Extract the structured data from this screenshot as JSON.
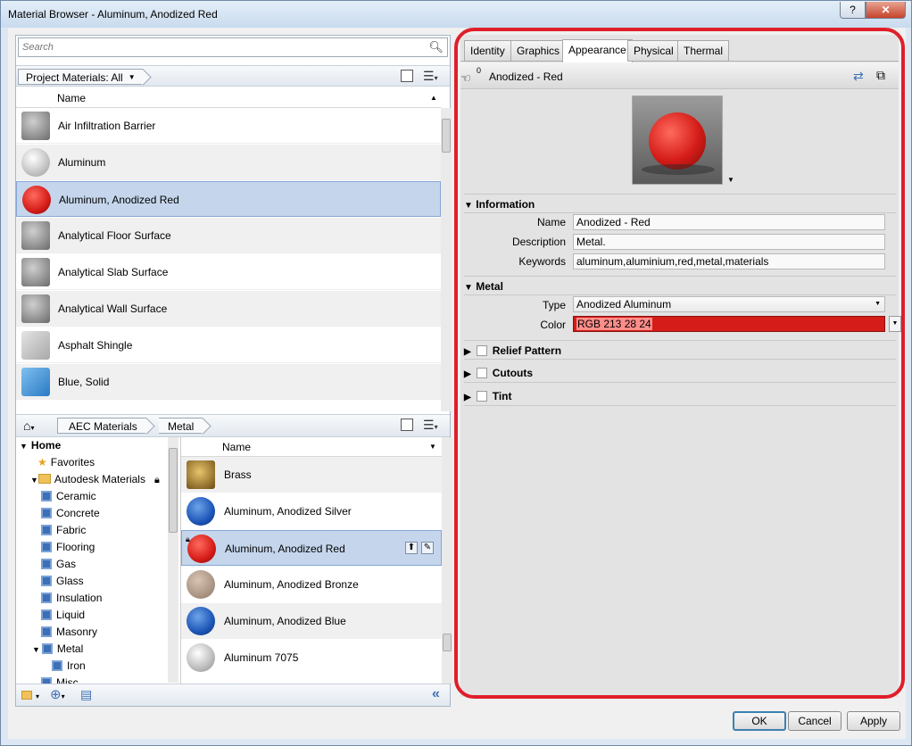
{
  "window": {
    "title": "Material Browser - Aluminum, Anodized Red",
    "help": "?",
    "close": "✕"
  },
  "search": {
    "placeholder": "Search"
  },
  "project": {
    "filter_label": "Project Materials: All",
    "column_name": "Name",
    "items": [
      {
        "label": "Air Infiltration Barrier",
        "swatch": "sphere-gray"
      },
      {
        "label": "Aluminum",
        "swatch": "sphere-silver"
      },
      {
        "label": "Aluminum, Anodized Red",
        "swatch": "sphere-red"
      },
      {
        "label": "Analytical Floor Surface",
        "swatch": "sphere-gray"
      },
      {
        "label": "Analytical Slab Surface",
        "swatch": "sphere-gray"
      },
      {
        "label": "Analytical Wall Surface",
        "swatch": "sphere-gray"
      },
      {
        "label": "Asphalt Shingle",
        "swatch": "cube-gray"
      },
      {
        "label": "Blue, Solid",
        "swatch": "cube-blue"
      }
    ]
  },
  "library": {
    "crumbs": [
      "AEC Materials",
      "Metal"
    ],
    "column_name": "Name",
    "tree": [
      {
        "label": "Home",
        "level": 0,
        "kind": "home"
      },
      {
        "label": "Favorites",
        "level": 1,
        "kind": "star"
      },
      {
        "label": "Autodesk Materials",
        "level": 1,
        "kind": "folder"
      },
      {
        "label": "Ceramic",
        "level": 2,
        "kind": "cat"
      },
      {
        "label": "Concrete",
        "level": 2,
        "kind": "cat"
      },
      {
        "label": "Fabric",
        "level": 2,
        "kind": "cat"
      },
      {
        "label": "Flooring",
        "level": 2,
        "kind": "cat"
      },
      {
        "label": "Gas",
        "level": 2,
        "kind": "cat"
      },
      {
        "label": "Glass",
        "level": 2,
        "kind": "cat"
      },
      {
        "label": "Insulation",
        "level": 2,
        "kind": "cat"
      },
      {
        "label": "Liquid",
        "level": 2,
        "kind": "cat"
      },
      {
        "label": "Masonry",
        "level": 2,
        "kind": "cat"
      },
      {
        "label": "Metal",
        "level": 2,
        "kind": "cat"
      },
      {
        "label": "Iron",
        "level": 3,
        "kind": "cat"
      },
      {
        "label": "Misc",
        "level": 2,
        "kind": "cat"
      }
    ],
    "items": [
      {
        "label": "Brass"
      },
      {
        "label": "Aluminum, Anodized Silver"
      },
      {
        "label": "Aluminum, Anodized Red"
      },
      {
        "label": "Aluminum, Anodized Bronze"
      },
      {
        "label": "Aluminum, Anodized Blue"
      },
      {
        "label": "Aluminum 7075"
      }
    ]
  },
  "tabs": [
    "Identity",
    "Graphics",
    "Appearance",
    "Physical",
    "Thermal"
  ],
  "asset": {
    "name": "Anodized - Red",
    "count": "0"
  },
  "information": {
    "title": "Information",
    "name_label": "Name",
    "name": "Anodized - Red",
    "description_label": "Description",
    "description": "Metal.",
    "keywords_label": "Keywords",
    "keywords": "aluminum,aluminium,red,metal,materials"
  },
  "metal": {
    "title": "Metal",
    "type_label": "Type",
    "type": "Anodized Aluminum",
    "color_label": "Color",
    "color": "RGB 213 28 24",
    "color_hex": "#d51c18"
  },
  "sections": [
    "Relief Pattern",
    "Cutouts",
    "Tint"
  ],
  "buttons": {
    "ok": "OK",
    "cancel": "Cancel",
    "apply": "Apply"
  }
}
